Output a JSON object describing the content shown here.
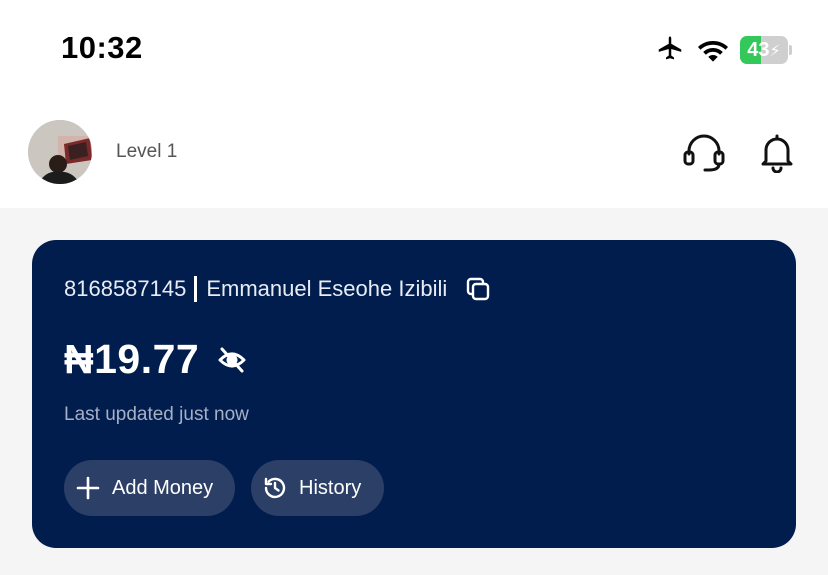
{
  "status_bar": {
    "time": "10:32",
    "battery_level": "43",
    "battery_fraction": 0.43,
    "icons": [
      "airplane-icon",
      "wifi-icon",
      "battery-charging-icon"
    ]
  },
  "header": {
    "level": "Level 1",
    "icons": [
      "support-headset-icon",
      "notification-bell-icon"
    ]
  },
  "wallet": {
    "account_number": "8168587145",
    "account_name": "Emmanuel Eseohe Izibili",
    "balance": "₦19.77",
    "last_updated": "Last updated just now",
    "add_money_label": "Add Money",
    "history_label": "History"
  },
  "colors": {
    "card_bg": "#001d4e",
    "button_bg": "#2c3f67",
    "battery_green": "#34c759",
    "page_bg": "#f5f5f5"
  }
}
